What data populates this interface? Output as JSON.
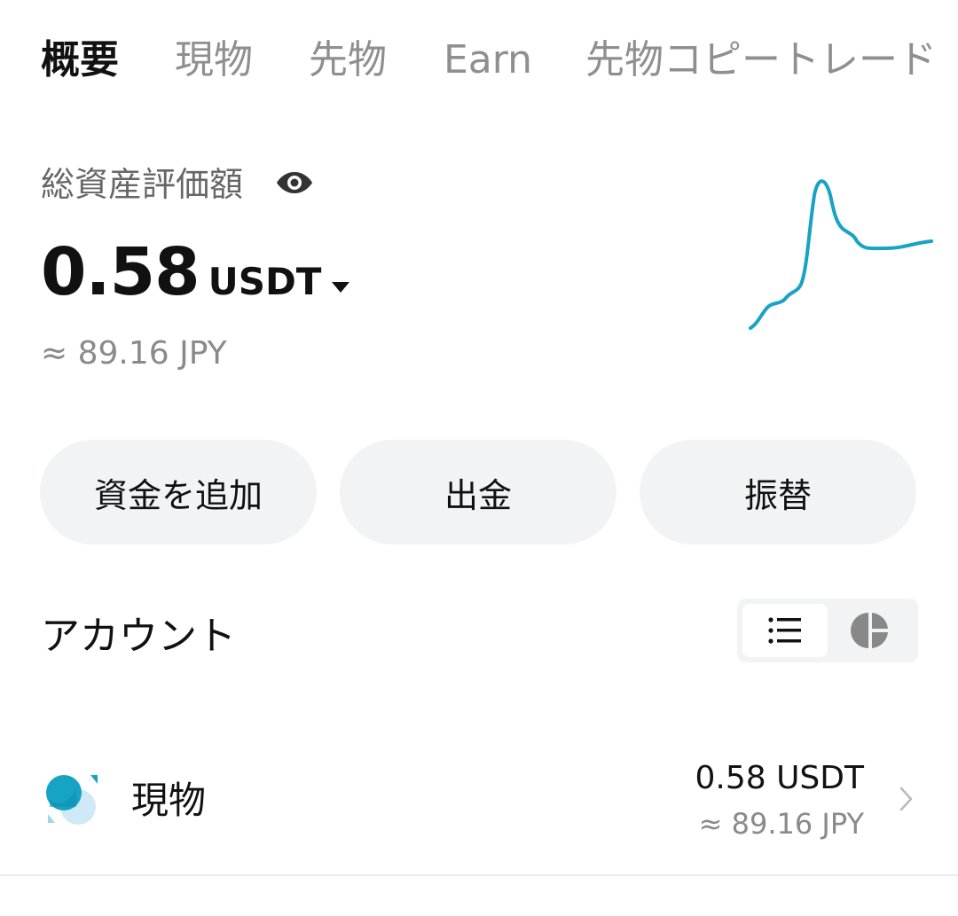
{
  "tabs": [
    {
      "label": "概要",
      "active": true
    },
    {
      "label": "現物",
      "active": false
    },
    {
      "label": "先物",
      "active": false
    },
    {
      "label": "Earn",
      "active": false
    },
    {
      "label": "先物コピートレード",
      "active": false
    }
  ],
  "summary": {
    "label": "総資産評価額",
    "amount": "0.58",
    "unit": "USDT",
    "approx": "≈ 89.16 JPY",
    "visibility_icon": "eye-icon",
    "sparkline_color": "#17a3c4"
  },
  "actions": {
    "deposit_label": "資金を追加",
    "withdraw_label": "出金",
    "transfer_label": "振替"
  },
  "accounts_section": {
    "title": "アカウント",
    "view_modes": [
      "list-icon",
      "pie-chart-icon"
    ],
    "active_view": "list"
  },
  "accounts": [
    {
      "name": "現物",
      "value": "0.58 USDT",
      "approx": "≈ 89.16 JPY",
      "icon": "spot-account-icon"
    }
  ],
  "colors": {
    "accent": "#17a3c4",
    "button_bg": "#f2f3f5",
    "muted_text": "#8a8a8a"
  }
}
